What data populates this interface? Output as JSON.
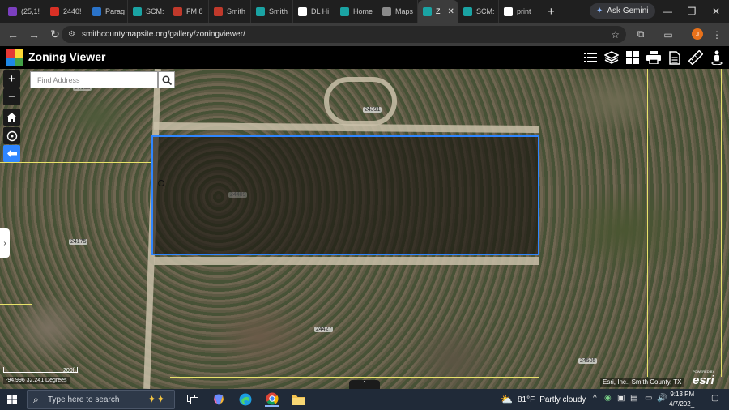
{
  "browser": {
    "tabs": [
      {
        "label": "(25,1!",
        "color": "#7b3fbf"
      },
      {
        "label": "2440!",
        "color": "#d93025"
      },
      {
        "label": "Parag",
        "color": "#2a73c9"
      },
      {
        "label": "SCM:",
        "color": "#1aa3a3"
      },
      {
        "label": "FM 8",
        "color": "#c0392b"
      },
      {
        "label": "Smith",
        "color": "#c0392b"
      },
      {
        "label": "Smith",
        "color": "#1aa3a3"
      },
      {
        "label": "DL Hi",
        "color": "#ffffff"
      },
      {
        "label": "Home",
        "color": "#1aa3a3"
      },
      {
        "label": "Maps",
        "color": "#8a8a8a"
      },
      {
        "label": "Z",
        "color": "#1aa3a3",
        "active": true
      },
      {
        "label": "SCM:",
        "color": "#1aa3a3"
      },
      {
        "label": "print",
        "color": "#ffffff"
      }
    ],
    "new_tab": "+",
    "gemini_label": "Ask Gemini",
    "url": "smithcountymapsite.org/gallery/zoningviewer/",
    "profile_initial": "J"
  },
  "app": {
    "title": "Zoning Viewer"
  },
  "map": {
    "search_placeholder": "Find Address",
    "zoom_in": "+",
    "zoom_out": "−",
    "parcel_labels": {
      "p24391": "24391",
      "p24409": "24409",
      "p24175": "24175",
      "p24427": "24427",
      "p24505": "24505",
      "p24153": "24153"
    },
    "scale_label": "200ft",
    "coordinates": "-94.996 32.241 Degrees",
    "attribution": "Esri, Inc., Smith County, TX",
    "esri_powered": "POWERED BY",
    "esri_name": "esri"
  },
  "taskbar": {
    "search_placeholder": "Type here to search",
    "temperature": "81°F",
    "weather_text": "Partly cloudy",
    "time": "9:13 PM",
    "date": "4/7/202_"
  }
}
